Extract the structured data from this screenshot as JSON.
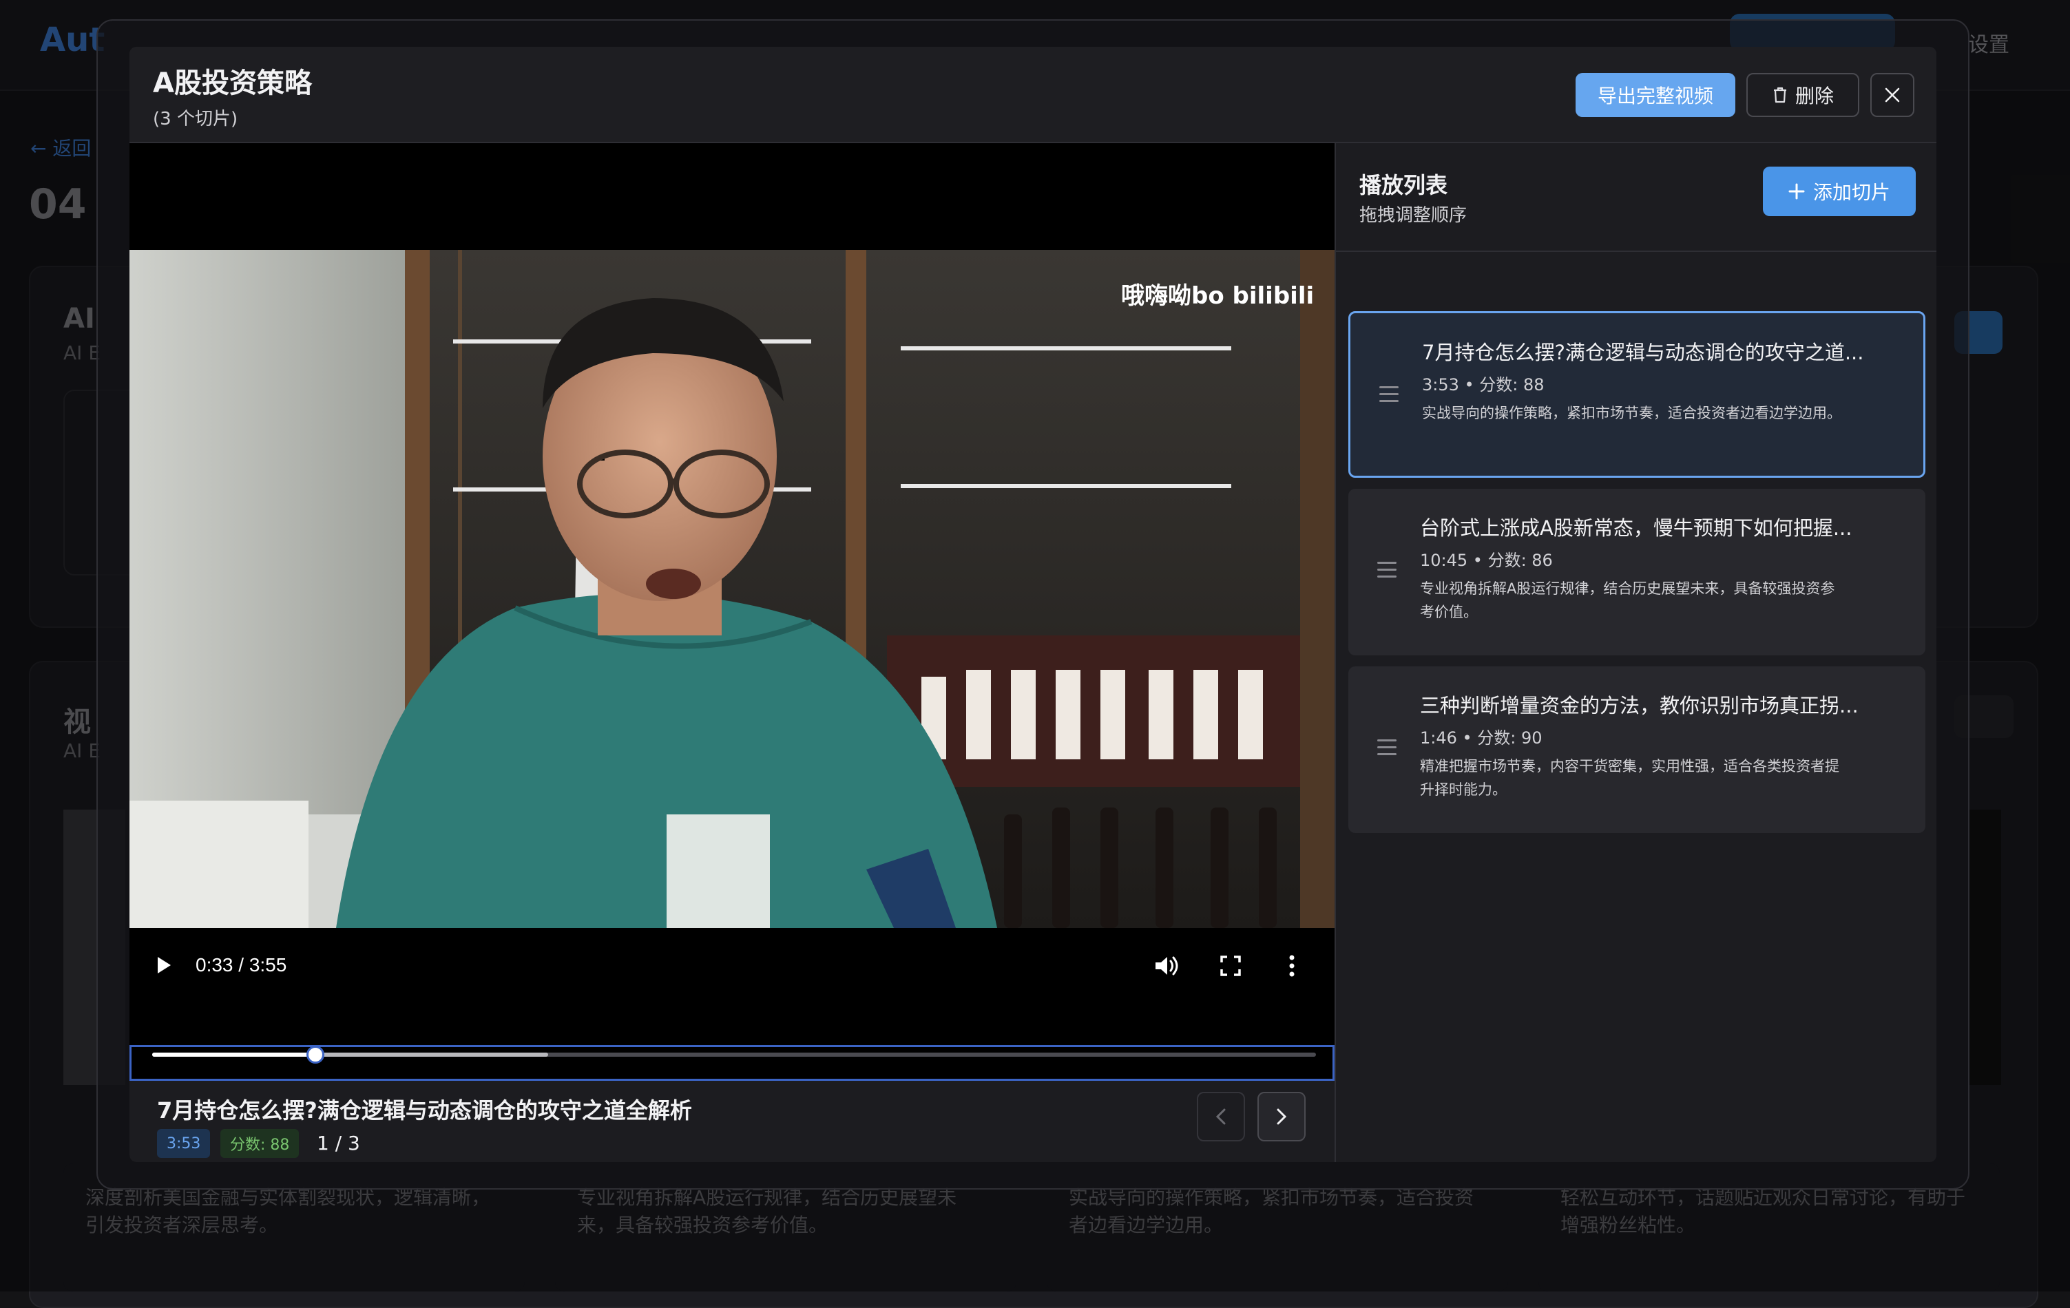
{
  "background": {
    "logo": "Aut",
    "settings": "设置",
    "back": "返回",
    "date": "04",
    "panel1_title": "AI",
    "panel1_sub": "AI E",
    "panel2_title": "视",
    "panel2_sub": "AI E",
    "cards": [
      "深度剖析美国金融与实体割裂现状，逻辑清晰，引发投资者深层思考。",
      "专业视角拆解A股运行规律，结合历史展望未来，具备较强投资参考价值。",
      "实战导向的操作策略，紧扣市场节奏，适合投资者边看边学边用。",
      "轻松互动环节，话题贴近观众日常讨论，有助于增强粉丝粘性。"
    ]
  },
  "modal": {
    "title": "A股投资策略",
    "count": "(3 个切片)",
    "export_label": "导出完整视频",
    "delete_label": "删除"
  },
  "player": {
    "time": "0:33 / 3:55",
    "watermark": "哦嗨呦bo bilibili",
    "progress_fraction": 0.14,
    "buffered_fraction": 0.34,
    "current_title": "7月持仓怎么摆?满仓逻辑与动态调仓的攻守之道全解析",
    "duration_tag": "3:53",
    "score_tag": "分数: 88",
    "pager": "1 / 3"
  },
  "playlist": {
    "title": "播放列表",
    "subtitle": "拖拽调整顺序",
    "add_label": "添加切片",
    "items": [
      {
        "title": "7月持仓怎么摆?满仓逻辑与动态调仓的攻守之道...",
        "meta": "3:53 • 分数: 88",
        "desc": "实战导向的操作策略，紧扣市场节奏，适合投资者边看边学边用。"
      },
      {
        "title": "台阶式上涨成A股新常态，慢牛预期下如何把握...",
        "meta": "10:45 • 分数: 86",
        "desc": "专业视角拆解A股运行规律，结合历史展望未来，具备较强投资参考价值。"
      },
      {
        "title": "三种判断增量资金的方法，教你识别市场真正拐...",
        "meta": "1:46 • 分数: 90",
        "desc": "精准把握市场节奏，内容干货密集，实用性强，适合各类投资者提升择时能力。"
      }
    ]
  },
  "colors": {
    "accent": "#4a95e8",
    "export": "#66a6ef",
    "active_border": "#6aa5f0"
  }
}
